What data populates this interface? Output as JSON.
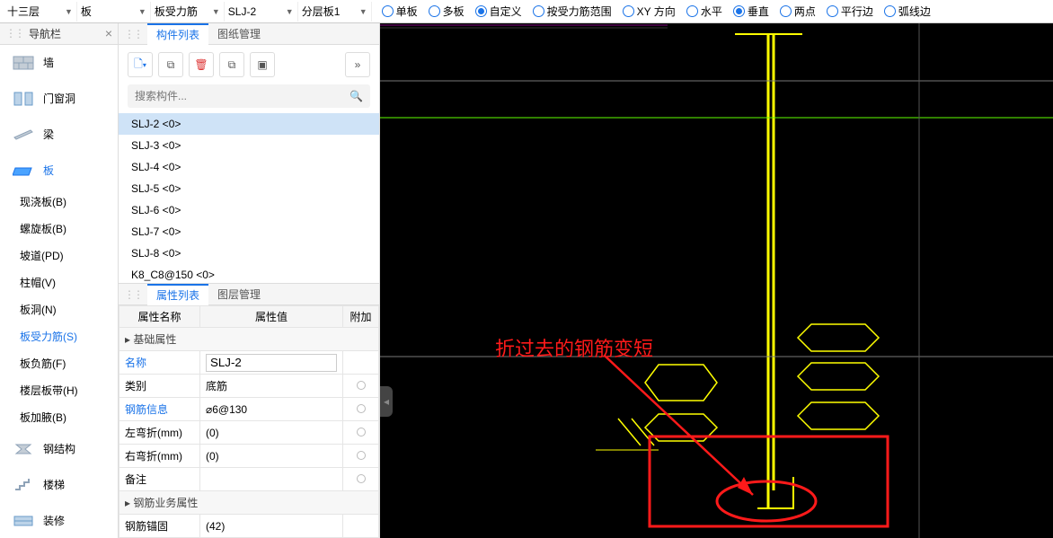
{
  "topbar": {
    "dropdowns": [
      {
        "label": "十三层"
      },
      {
        "label": "板"
      },
      {
        "label": "板受力筋"
      },
      {
        "label": "SLJ-2"
      },
      {
        "label": "分层板1"
      }
    ],
    "radios": [
      {
        "label": "单板",
        "selected": false
      },
      {
        "label": "多板",
        "selected": false
      },
      {
        "label": "自定义",
        "selected": true
      },
      {
        "label": "按受力筋范围",
        "selected": false
      },
      {
        "label": "XY 方向",
        "selected": false
      },
      {
        "label": "水平",
        "selected": false
      },
      {
        "label": "垂直",
        "selected": true
      },
      {
        "label": "两点",
        "selected": false
      },
      {
        "label": "平行边",
        "selected": false
      },
      {
        "label": "弧线边",
        "selected": false
      }
    ]
  },
  "nav": {
    "title": "导航栏",
    "items": [
      {
        "label": "墙",
        "icon": "wall"
      },
      {
        "label": "门窗洞",
        "icon": "opening"
      },
      {
        "label": "梁",
        "icon": "beam"
      },
      {
        "label": "板",
        "icon": "slab",
        "active": true
      },
      {
        "label": "现浇板(B)",
        "sub": true
      },
      {
        "label": "螺旋板(B)",
        "sub": true
      },
      {
        "label": "坡道(PD)",
        "sub": true
      },
      {
        "label": "柱帽(V)",
        "sub": true
      },
      {
        "label": "板洞(N)",
        "sub": true
      },
      {
        "label": "板受力筋(S)",
        "sub": true,
        "active": true
      },
      {
        "label": "板负筋(F)",
        "sub": true
      },
      {
        "label": "楼层板带(H)",
        "sub": true
      },
      {
        "label": "板加腋(B)",
        "sub": true
      },
      {
        "label": "钢结构",
        "icon": "steel"
      },
      {
        "label": "楼梯",
        "icon": "stair"
      },
      {
        "label": "装修",
        "icon": "decor"
      }
    ]
  },
  "components": {
    "tabs": [
      {
        "label": "构件列表",
        "active": true
      },
      {
        "label": "图纸管理"
      }
    ],
    "search_placeholder": "搜索构件...",
    "items": [
      {
        "label": "SLJ-2 <0>",
        "sel": true
      },
      {
        "label": "SLJ-3 <0>"
      },
      {
        "label": "SLJ-4 <0>"
      },
      {
        "label": "SLJ-5 <0>"
      },
      {
        "label": "SLJ-6 <0>"
      },
      {
        "label": "SLJ-7 <0>"
      },
      {
        "label": "SLJ-8 <0>"
      },
      {
        "label": "K8_C8@150 <0>"
      }
    ]
  },
  "properties": {
    "tabs": [
      {
        "label": "属性列表",
        "active": true
      },
      {
        "label": "图层管理"
      }
    ],
    "headers": {
      "name": "属性名称",
      "value": "属性值",
      "extra": "附加"
    },
    "groups": [
      {
        "title": "基础属性",
        "rows": [
          {
            "name": "名称",
            "value": "SLJ-2",
            "link": true,
            "input": true
          },
          {
            "name": "类别",
            "value": "底筋",
            "attach": true
          },
          {
            "name": "钢筋信息",
            "value": "⌀6@130",
            "link": true,
            "attach": true
          },
          {
            "name": "左弯折(mm)",
            "value": "(0)",
            "attach": true
          },
          {
            "name": "右弯折(mm)",
            "value": "(0)",
            "attach": true
          },
          {
            "name": "备注",
            "value": "",
            "attach": true
          }
        ]
      },
      {
        "title": "钢筋业务属性",
        "rows": [
          {
            "name": "钢筋锚固",
            "value": "(42)"
          }
        ]
      }
    ]
  },
  "annotation": {
    "text": "折过去的钢筋变短"
  }
}
